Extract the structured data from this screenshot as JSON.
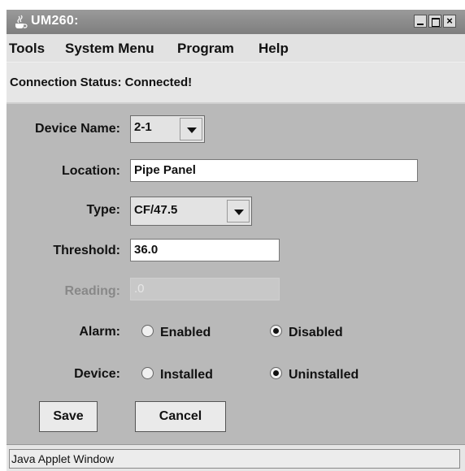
{
  "window": {
    "title": "UM260:"
  },
  "menu": [
    "Tools",
    "System Menu",
    "Program",
    "Help"
  ],
  "connection": {
    "status_text": "Connection Status: Connected!"
  },
  "form": {
    "device_name_label": "Device Name:",
    "device_name_value": "2-1",
    "location_label": "Location:",
    "location_value": "Pipe Panel",
    "type_label": "Type:",
    "type_value": "CF/47.5",
    "threshold_label": "Threshold:",
    "threshold_value": "36.0",
    "reading_label": "Reading:",
    "reading_value": ".0",
    "alarm_label": "Alarm:",
    "alarm_enabled": "Enabled",
    "alarm_disabled": "Disabled",
    "alarm_selected": "Disabled",
    "device_label": "Device:",
    "device_installed": "Installed",
    "device_uninstalled": "Uninstalled",
    "device_selected": "Uninstalled"
  },
  "buttons": {
    "save": "Save",
    "cancel": "Cancel"
  },
  "footer": {
    "applet_text": "Java Applet Window"
  },
  "icons": {
    "app": "java-cup-icon",
    "minimize": "minimize-icon",
    "maximize": "maximize-icon",
    "close": "close-icon",
    "dropdown": "chevron-down-icon"
  },
  "colors": {
    "titlebar": "#8c8c8c",
    "panel": "#b9b9b9",
    "menubar": "#e2e2e2"
  }
}
